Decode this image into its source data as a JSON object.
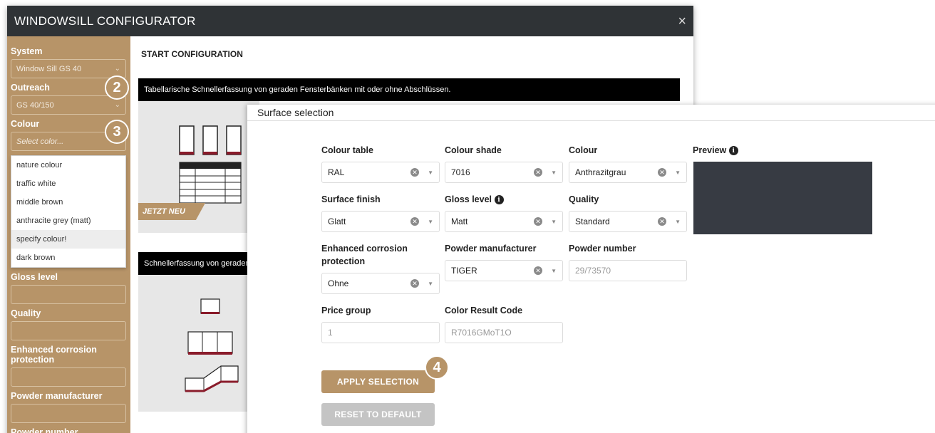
{
  "config_window": {
    "title": "WINDOWSILL CONFIGURATOR",
    "close": "×",
    "start_label": "START CONFIGURATION",
    "banner1": "Tabellarische Schnellerfassung von geraden Fensterbänken mit oder ohne Abschlüssen.",
    "banner2": "Schnellerfassung von geraden u",
    "jetzt_neu": "JETZT NEU"
  },
  "sidebar": {
    "system_label": "System",
    "system_value": "Window Sill GS 40",
    "outreach_label": "Outreach",
    "outreach_value": "GS 40/150",
    "colour_label": "Colour",
    "colour_placeholder": "Select color...",
    "colour_options": [
      "nature colour",
      "traffic white",
      "middle brown",
      "anthracite grey (matt)",
      "specify colour!",
      "dark brown"
    ],
    "gloss_label": "Gloss level",
    "quality_label": "Quality",
    "corrosion_label_1": "Enhanced corrosion",
    "corrosion_label_2": "protection",
    "powder_manufacturer_label": "Powder manufacturer",
    "powder_number_label": "Powder number"
  },
  "steps": {
    "s2": "2",
    "s3": "3",
    "s4": "4"
  },
  "surface": {
    "title": "Surface selection",
    "close": "×",
    "colour_table_label": "Colour table",
    "colour_table_value": "RAL",
    "colour_shade_label": "Colour shade",
    "colour_shade_value": "7016",
    "colour_label": "Colour",
    "colour_value": "Anthrazitgrau",
    "preview_label": "Preview",
    "surface_finish_label": "Surface finish",
    "surface_finish_value": "Glatt",
    "gloss_level_label": "Gloss level",
    "gloss_level_value": "Matt",
    "quality_label": "Quality",
    "quality_value": "Standard",
    "corrosion_label_1": "Enhanced corrosion",
    "corrosion_label_2": "protection",
    "corrosion_value": "Ohne",
    "powder_manufacturer_label": "Powder manufacturer",
    "powder_manufacturer_value": "TIGER",
    "powder_number_label": "Powder number",
    "powder_number_value": "29/73570",
    "price_group_label": "Price group",
    "price_group_value": "1",
    "color_result_label": "Color Result Code",
    "color_result_value": "R7016GMoT1O",
    "apply_label": "APPLY SELECTION",
    "reset_label": "RESET TO DEFAULT",
    "preview_color": "#373b43"
  },
  "colors": {
    "accent": "#b79468",
    "titlebar": "#2f3336"
  }
}
